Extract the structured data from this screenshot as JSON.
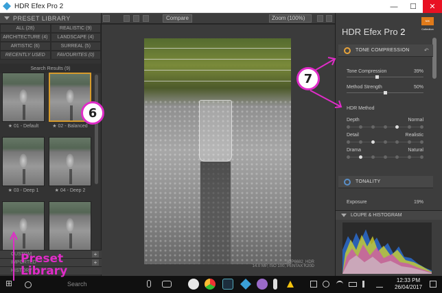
{
  "window": {
    "title": "HDR Efex Pro 2",
    "controls": [
      "—",
      "☐",
      "✕"
    ]
  },
  "library": {
    "header": "PRESET LIBRARY",
    "categories": [
      "ALL (28)",
      "REALISTIC (9)",
      "ARCHITECTURE (4)",
      "LANDSCAPE (4)",
      "ARTISTIC (6)",
      "SURREAL (5)",
      "RECENTLY USED",
      "FAVOURITES (0)"
    ],
    "results_label": "Search Results (9)",
    "presets": [
      {
        "name": "★ 01 - Default",
        "selected": false
      },
      {
        "name": "★ 02 - Balanced",
        "selected": true
      },
      {
        "name": "★ 03 - Deep 1",
        "selected": false
      },
      {
        "name": "★ 04 - Deep 2",
        "selected": false
      },
      {
        "name": "",
        "selected": false
      },
      {
        "name": "",
        "selected": false
      }
    ],
    "bottom_rows": [
      "CUSTOM",
      "IMPORTED",
      "HISTORY"
    ]
  },
  "toolbar": {
    "compare_label": "Compare",
    "zoom_label": "Zoom (100%)"
  },
  "preview": {
    "caption": "_IGP6682_HDR\n14.0 MP, ISO 100, PENTAX K20D"
  },
  "right_panel": {
    "brand_name": "HDR Efex Pro",
    "brand_version": "2",
    "badge_text": "NIK Collection",
    "tone_compression": {
      "title": "TONE COMPRESSION",
      "reset_icon": "undo-icon",
      "params": [
        {
          "label": "Tone Compression",
          "value": "39%",
          "level": 0.39
        },
        {
          "label": "Method Strength",
          "value": "50%",
          "level": 0.5
        }
      ]
    },
    "hdr_method": {
      "title": "HDR Method",
      "rows": [
        {
          "left": "Depth",
          "right": "Normal",
          "level": 0.6
        },
        {
          "left": "Detail",
          "right": "Realistic",
          "level": 0.25
        },
        {
          "left": "Drama",
          "right": "Natural",
          "level": 0.2
        }
      ]
    },
    "tonality": {
      "title": "TONALITY",
      "exposure_label": "Exposure",
      "exposure_value": "19%"
    },
    "loupe": {
      "title": "LOUPE & HISTOGRAM"
    }
  },
  "taskbar": {
    "search_placeholder": "Search",
    "time": "12:33 PM",
    "date": "26/04/2017"
  },
  "annotations": {
    "label_6": "6",
    "label_7": "7",
    "preset_library_text": "Preset\nLibrary",
    "color": "#e02cc8"
  }
}
